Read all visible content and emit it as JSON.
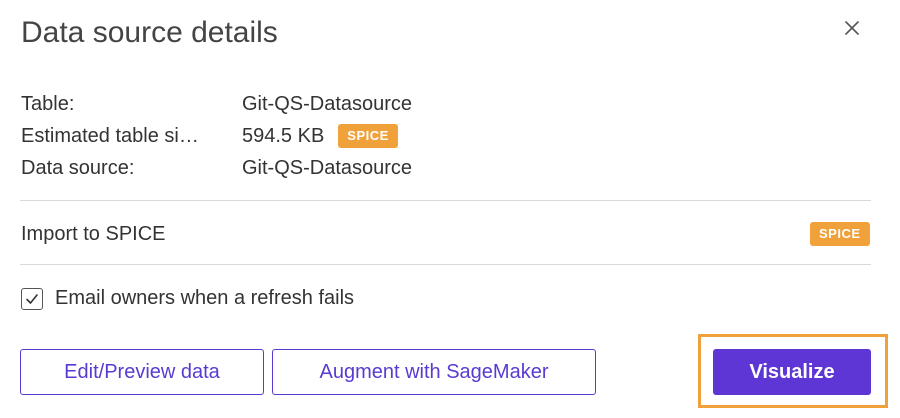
{
  "dialog": {
    "title": "Data source details",
    "close_icon": "close-icon"
  },
  "details": [
    {
      "label": "Table:",
      "value": "Git-QS-Datasource",
      "badge": ""
    },
    {
      "label": "Estimated table si…",
      "value": "594.5 KB",
      "badge": "SPICE"
    },
    {
      "label": "Data source:",
      "value": "Git-QS-Datasource",
      "badge": ""
    }
  ],
  "import": {
    "label": "Import to SPICE",
    "badge": "SPICE"
  },
  "email_option": {
    "label": "Email owners when a refresh fails",
    "checked": true
  },
  "buttons": {
    "edit_preview": "Edit/Preview data",
    "augment": "Augment with SageMaker",
    "visualize": "Visualize"
  },
  "colors": {
    "accent": "#5f36d6",
    "badge": "#f0a13a",
    "highlight": "#f0a13a"
  }
}
